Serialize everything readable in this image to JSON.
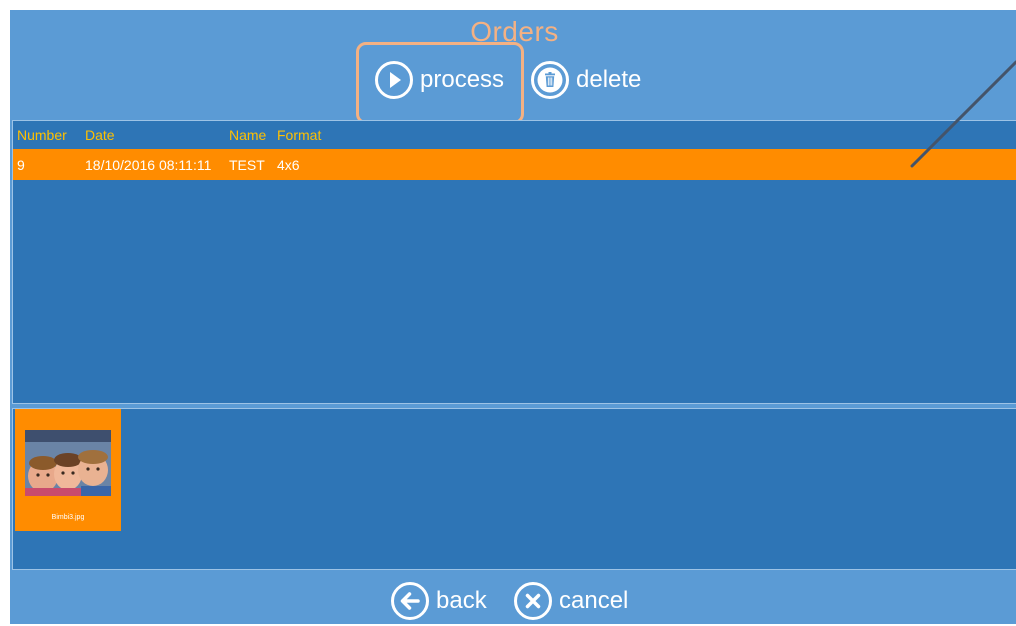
{
  "window": {
    "title": "Orders"
  },
  "toolbar": {
    "process_label": "process",
    "delete_label": "delete"
  },
  "orders": {
    "columns": {
      "number": "Number",
      "date": "Date",
      "name": "Name",
      "format": "Format"
    },
    "rows": [
      {
        "number": "9",
        "date": "18/10/2016 08:11:11",
        "name": "TEST",
        "format": "4x6"
      }
    ]
  },
  "thumbnails": [
    {
      "filename": "Bimbi3.jpg"
    }
  ],
  "footer": {
    "back_label": "back",
    "cancel_label": "cancel"
  },
  "icons": {
    "process": "play-circle-icon",
    "delete": "trash-circle-icon",
    "back": "arrow-left-circle-icon",
    "cancel": "x-circle-icon"
  },
  "colors": {
    "background": "#5b9bd5",
    "panel": "#2e75b6",
    "selection": "#ff8c00",
    "header_text": "#ffc000",
    "title_text": "#f4b183",
    "highlight": "#f4b183",
    "annotation_line": "#44546a"
  }
}
